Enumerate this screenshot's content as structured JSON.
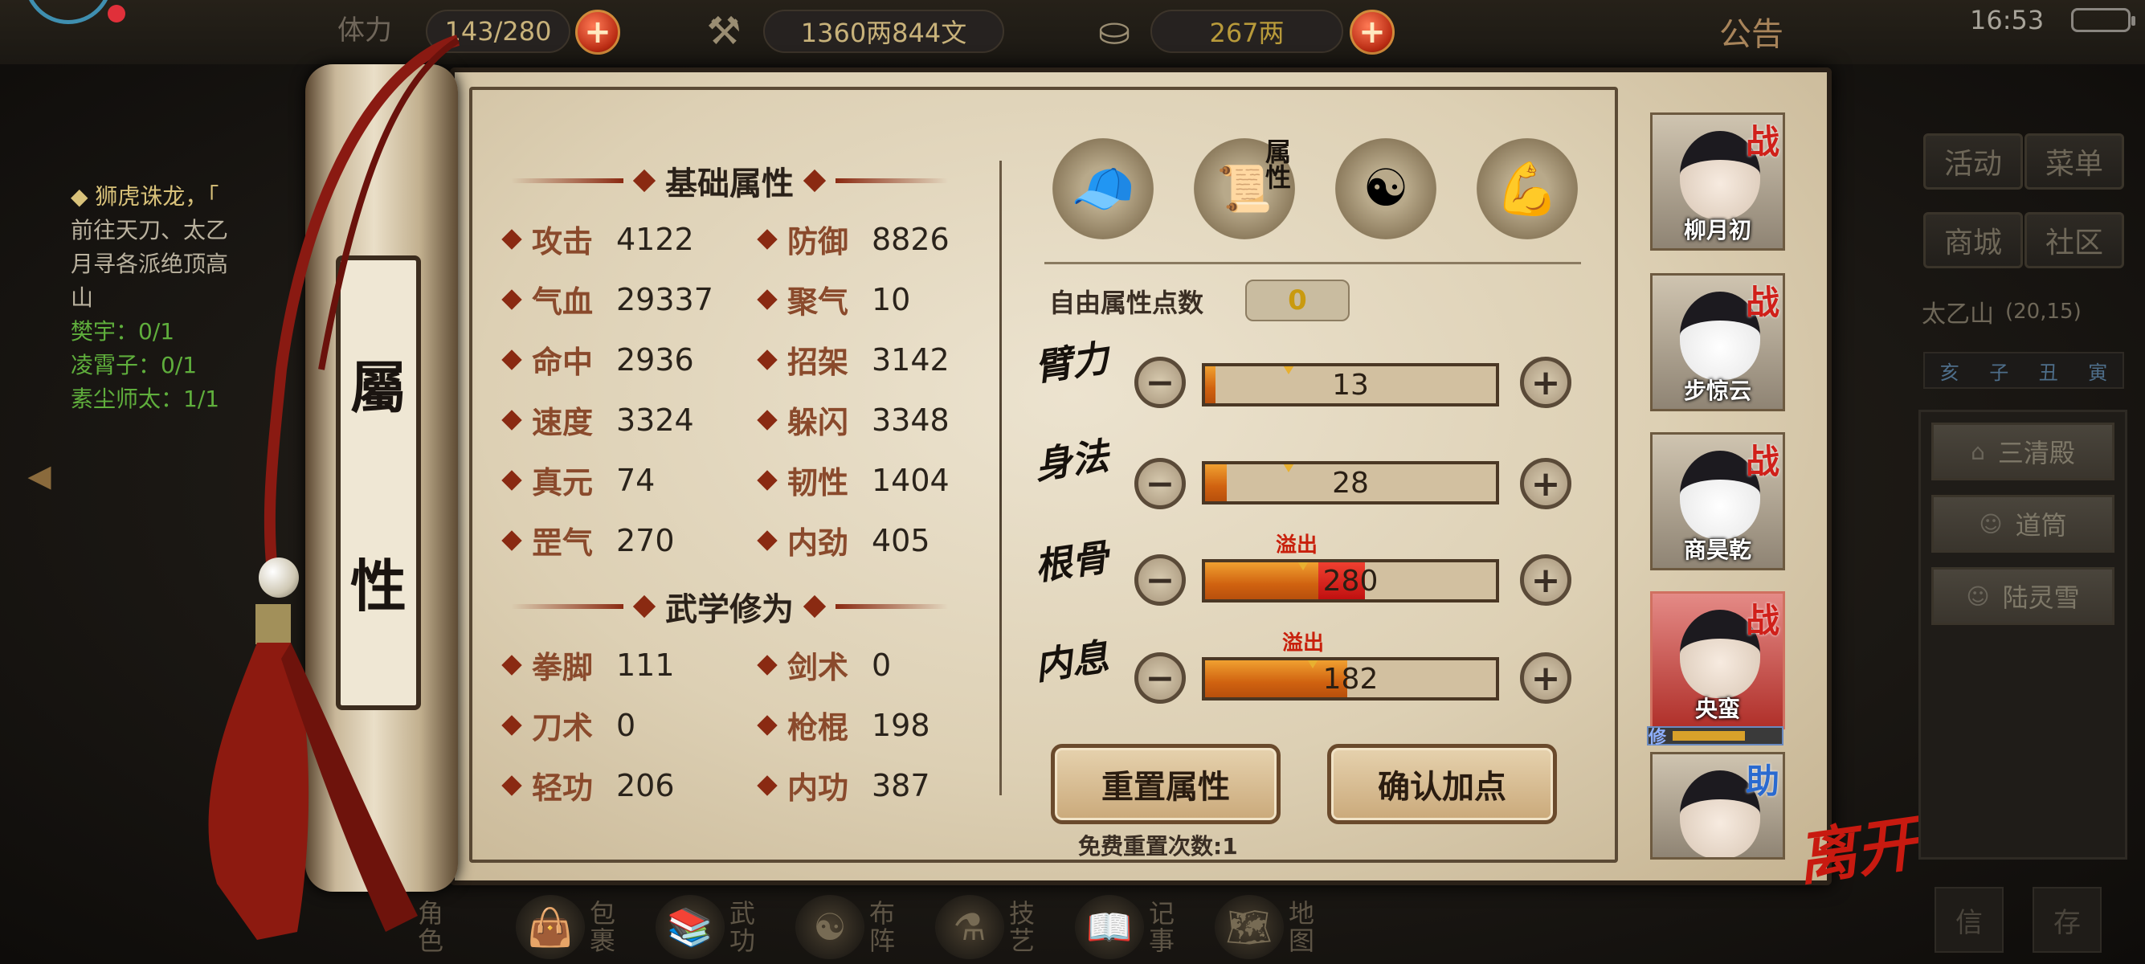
{
  "topbar": {
    "stamina": "143/280",
    "money": "1360两844文",
    "gold": "267两",
    "notice": "公告",
    "time": "16:53"
  },
  "quest": {
    "title": "◆ 狮虎诛龙，「",
    "desc": [
      "前往天刀、太乙",
      "月寻各派绝顶高",
      "山"
    ],
    "progress": [
      {
        "label": "樊宇：0/1"
      },
      {
        "label": "凌霄子：0/1"
      },
      {
        "label": "素尘师太：1/1"
      }
    ]
  },
  "scroll_title": [
    "屬",
    "性"
  ],
  "basic": {
    "heading": "基础属性",
    "stats": [
      {
        "label": "攻击",
        "value": "4122"
      },
      {
        "label": "防御",
        "value": "8826"
      },
      {
        "label": "气血",
        "value": "29337"
      },
      {
        "label": "聚气",
        "value": "10"
      },
      {
        "label": "命中",
        "value": "2936"
      },
      {
        "label": "招架",
        "value": "3142"
      },
      {
        "label": "速度",
        "value": "3324"
      },
      {
        "label": "躲闪",
        "value": "3348"
      },
      {
        "label": "真元",
        "value": "74"
      },
      {
        "label": "韧性",
        "value": "1404"
      },
      {
        "label": "罡气",
        "value": "270"
      },
      {
        "label": "内劲",
        "value": "405"
      }
    ]
  },
  "martial": {
    "heading": "武学修为",
    "stats": [
      {
        "label": "拳脚",
        "value": "111"
      },
      {
        "label": "剑术",
        "value": "0"
      },
      {
        "label": "刀术",
        "value": "0"
      },
      {
        "label": "枪棍",
        "value": "198"
      },
      {
        "label": "轻功",
        "value": "206"
      },
      {
        "label": "内功",
        "value": "387"
      }
    ]
  },
  "tabs": {
    "attr_tab_label": "属性"
  },
  "free_points": {
    "label": "自由属性点数",
    "value": "0"
  },
  "attributes": [
    {
      "name": "臂力",
      "value": "13",
      "fill": 0.035,
      "overflow_fill": 0,
      "overflow_text": ""
    },
    {
      "name": "身法",
      "value": "28",
      "fill": 0.075,
      "overflow_fill": 0,
      "overflow_text": ""
    },
    {
      "name": "根骨",
      "value": "280",
      "fill": 0.39,
      "overflow_fill": 0.16,
      "overflow_text": "溢出"
    },
    {
      "name": "内息",
      "value": "182",
      "fill": 0.49,
      "overflow_fill": 0,
      "overflow_text": "溢出"
    }
  ],
  "buttons": {
    "reset": "重置属性",
    "confirm": "确认加点",
    "reset_count": "免费重置次数:1"
  },
  "party": [
    {
      "name": "柳月初",
      "tag": "战"
    },
    {
      "name": "步惊云",
      "tag": "战"
    },
    {
      "name": "商昊乾",
      "tag": "战"
    },
    {
      "name": "央蛮",
      "tag": "战"
    },
    {
      "name": "",
      "tag": "助"
    }
  ],
  "xiu_label": "修",
  "leave": "离开",
  "right_panel": {
    "buttons": [
      "活动",
      "菜单",
      "商城",
      "社区"
    ],
    "location": "太乙山",
    "coords": "(20,15)",
    "time_labels": [
      "亥",
      "子",
      "丑",
      "寅"
    ],
    "npcs": [
      "三清殿",
      "道筒",
      "陆灵雪"
    ],
    "bottom": [
      "信",
      "存"
    ]
  },
  "bottom_nav": [
    "角色",
    "包裹",
    "武功",
    "布阵",
    "技艺",
    "记事",
    "地图"
  ],
  "colors": {
    "accent_red": "#8a2a12",
    "overflow_red": "#c8200c",
    "bar_orange": "#d06210",
    "paper": "#ddd0b4"
  }
}
